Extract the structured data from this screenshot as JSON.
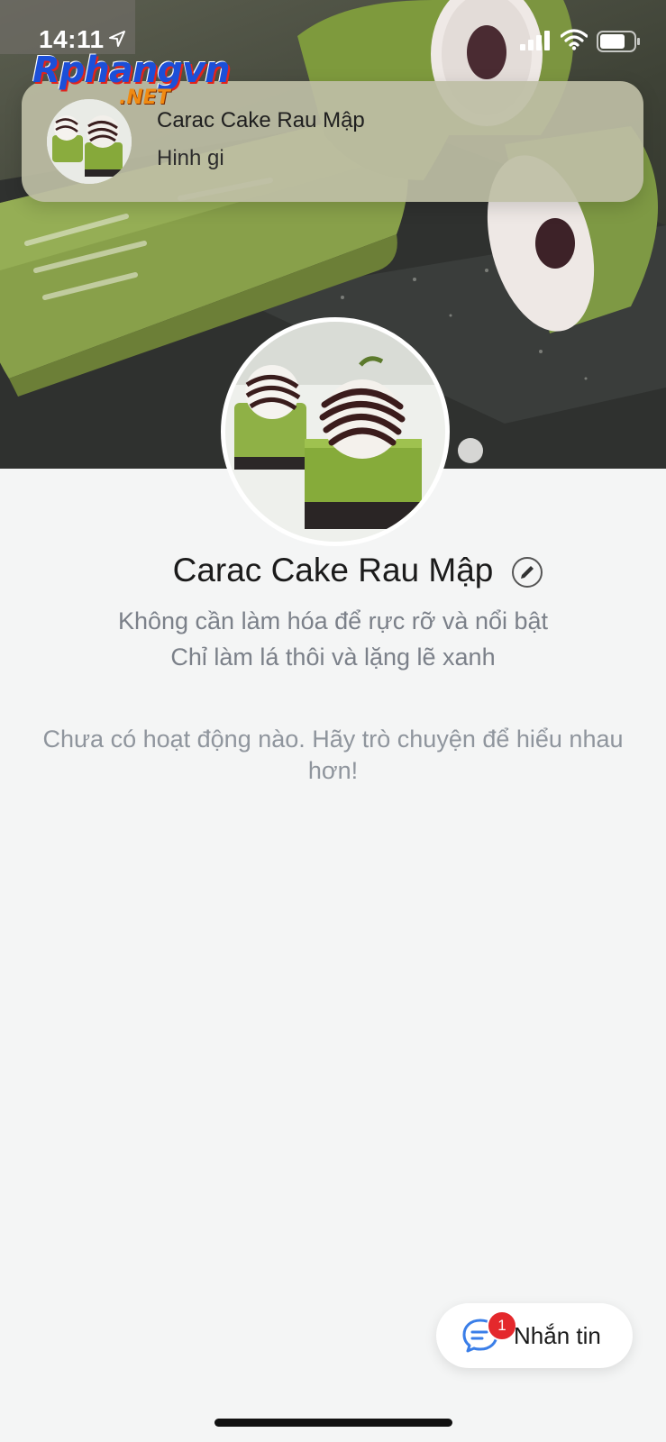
{
  "status_bar": {
    "time": "14:11",
    "icons": [
      "location-arrow-icon",
      "cellular-signal-icon",
      "wifi-icon",
      "battery-icon"
    ]
  },
  "watermark": {
    "main": "Rphangvn",
    "sub": ".NET"
  },
  "notification": {
    "title": "Carac Cake Rau Mập",
    "body": "Hinh gi"
  },
  "profile": {
    "name": "Carac Cake Rau Mập",
    "bio_line1": "Không cần làm hóa để rực rỡ và nổi bật",
    "bio_line2": "Chỉ làm lá thôi và lặng lẽ xanh",
    "empty_activity": "Chưa có hoạt động nào. Hãy trò chuyện để hiểu nhau hơn!"
  },
  "message_button": {
    "label": "Nhắn tin",
    "badge_count": "1",
    "icon": "chat-bubble-icon"
  },
  "colors": {
    "background": "#f4f5f5",
    "badge": "#e4282c",
    "matcha_green": "#7d9a3e",
    "chat_icon": "#3a7ee8"
  }
}
